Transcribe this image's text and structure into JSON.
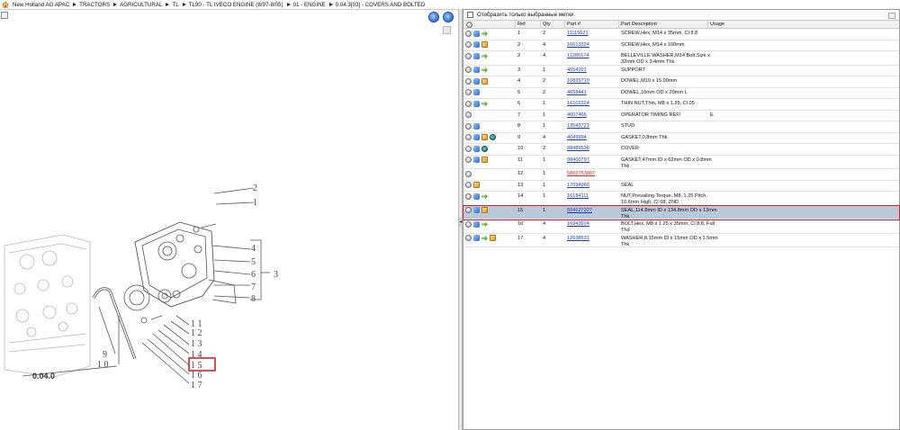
{
  "breadcrumb": {
    "items": [
      "New Holland AG APAC",
      "TRACTORS",
      "AGRICULTURAL",
      "TL",
      "TL90 - TL IVECO ENGINE (8/97-8/05)",
      "01 - ENGINE",
      "0.04.3[03] - COVERS AND BOLTED"
    ]
  },
  "drawing": {
    "section_label": "0.04.0",
    "callouts": [
      "1",
      "2",
      "3",
      "4",
      "5",
      "6",
      "7",
      "8",
      "9",
      "10",
      "11",
      "12",
      "13",
      "14",
      "15",
      "16",
      "17"
    ],
    "highlighted_ref": "15"
  },
  "filter": {
    "label": "Отобразить только выбранные метки"
  },
  "table": {
    "columns": [
      "Ref",
      "Qty",
      "Part #",
      "Part Description",
      "Usage"
    ],
    "rows": [
      {
        "icons": [
          "plus",
          "blue",
          "green"
        ],
        "ref": "1",
        "qty": "2",
        "part": "11115621",
        "desc": [
          "SCREW,Hex, M14 x 35mm, Cl 8.8"
        ],
        "usage": ""
      },
      {
        "icons": [
          "plus",
          "blue",
          "box"
        ],
        "ref": "2",
        "qty": "4",
        "part": "16613324",
        "desc": [
          "SCREW,Hex, M14 x 100mm"
        ],
        "usage": ""
      },
      {
        "icons": [
          "plus",
          "blue",
          "green"
        ],
        "ref": "2",
        "qty": "4",
        "part": "11280174",
        "desc": [
          "BELLEVILLE WASHER,M14 Bolt Size x",
          "32mm OD x 3.4mm Thk"
        ],
        "usage": ""
      },
      {
        "icons": [
          "plus",
          "blue",
          "green"
        ],
        "ref": "3",
        "qty": "1",
        "part": "4654391",
        "desc": [
          "SUPPORT"
        ],
        "usage": ""
      },
      {
        "icons": [
          "plus",
          "blue",
          "box"
        ],
        "ref": "4",
        "qty": "2",
        "part": "10839710",
        "desc": [
          "DOWEL,M10 x 15.00mm"
        ],
        "usage": ""
      },
      {
        "icons": [
          "plus",
          "blue"
        ],
        "ref": "5",
        "qty": "2",
        "part": "4658441",
        "desc": [
          "DOWEL,10mm OD x 20mm L"
        ],
        "usage": ""
      },
      {
        "icons": [
          "plus",
          "blue",
          "green"
        ],
        "ref": "6",
        "qty": "1",
        "part": "16102324",
        "desc": [
          "THIN NUT,Thin, M8 x 1.25, Cl 05"
        ],
        "usage": ""
      },
      {
        "icons": [
          "plus"
        ],
        "ref": "7",
        "qty": "1",
        "part": "4607466",
        "desc": [
          "OPERATOR TIMING REF/"
        ],
        "usage": "E"
      },
      {
        "icons": [
          "plus",
          "blue"
        ],
        "ref": "8",
        "qty": "1",
        "part": "13543721",
        "desc": [
          "STUD"
        ],
        "usage": ""
      },
      {
        "icons": [
          "plus",
          "blue",
          "box",
          "teal"
        ],
        "ref": "9",
        "qty": "4",
        "part": "4049994",
        "desc": [
          "GASKET,0.8mm Thk"
        ],
        "usage": ""
      },
      {
        "icons": [
          "plus",
          "blue",
          "teal"
        ],
        "ref": "10",
        "qty": "2",
        "part": "98489536",
        "desc": [
          "COVER"
        ],
        "usage": ""
      },
      {
        "icons": [
          "plus",
          "blue",
          "box"
        ],
        "ref": "11",
        "qty": "1",
        "part": "98400797",
        "desc": [
          "GASKET,47mm ID x 62mm OD x 0.8mm",
          "Thk"
        ],
        "usage": ""
      },
      {
        "icons": [
          "plus"
        ],
        "ref": "12",
        "qty": "1",
        "part": "5802753887",
        "desc": [],
        "usage": "",
        "alert": true
      },
      {
        "icons": [
          "plus",
          "box"
        ],
        "ref": "13",
        "qty": "1",
        "part": "17094960",
        "desc": [
          "SEAL"
        ],
        "usage": ""
      },
      {
        "icons": [
          "plus",
          "blue",
          "green"
        ],
        "ref": "14",
        "qty": "1",
        "part": "16184111",
        "desc": [
          "NUT,Prevailing Torque, M8, 1.25 Pitch,",
          "10.6mm High, Cl 08, ZND"
        ],
        "usage": ""
      },
      {
        "icons": [
          "plus",
          "blue",
          "box"
        ],
        "ref": "15",
        "qty": "1",
        "part": "504127327",
        "desc": [
          "SEAL,114.8mm ID x 134.8mm OD x 13mm",
          "Thk"
        ],
        "usage": "",
        "selected": true
      },
      {
        "icons": [
          "plus",
          "blue",
          "green"
        ],
        "ref": "16",
        "qty": "4",
        "part": "16943924",
        "desc": [
          "BOLT,Hex, M8 x 1.25 x 35mm, Cl 8.8, Full",
          "Thd"
        ],
        "usage": ""
      },
      {
        "icons": [
          "plus",
          "blue",
          "green",
          "box"
        ],
        "ref": "17",
        "qty": "4",
        "part": "12638531",
        "desc": [
          "WASHER,8.15mm ID x 15mm OD x 1.5mm",
          "Thk"
        ],
        "usage": ""
      }
    ]
  },
  "colors": {
    "accent": "#1a3ccc",
    "highlight": "#d91f26",
    "selected_row": "#b9c9da"
  }
}
